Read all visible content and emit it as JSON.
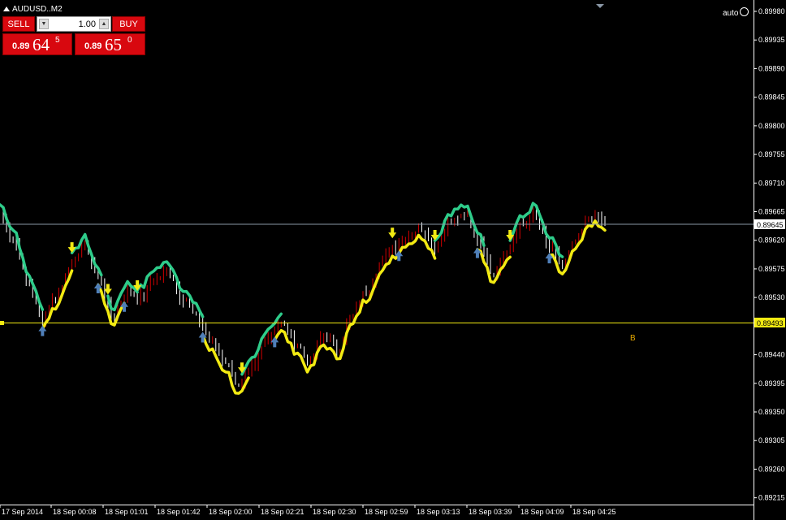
{
  "window": {
    "title": "AUDUSD..M2",
    "auto_label": "auto"
  },
  "trade_panel": {
    "sell_label": "SELL",
    "buy_label": "BUY",
    "lot_value": "1.00",
    "sell_price": {
      "big": "0.89",
      "pips": "64",
      "frac": "5"
    },
    "buy_price": {
      "big": "0.89",
      "pips": "65",
      "frac": "0"
    }
  },
  "chart_data": {
    "type": "bar",
    "symbol": "AUDUSD..",
    "timeframe": "M2",
    "ylim": [
      0.89212,
      0.8998
    ],
    "y_ticks": [
      "0.89980",
      "0.89935",
      "0.89890",
      "0.89845",
      "0.89800",
      "0.89755",
      "0.89710",
      "0.89665",
      "0.89620",
      "0.89575",
      "0.89530",
      "0.89440",
      "0.89395",
      "0.89350",
      "0.89305",
      "0.89260",
      "0.89215"
    ],
    "x_ticks": [
      "17 Sep 2014",
      "18 Sep 00:08",
      "18 Sep 01:01",
      "18 Sep 01:42",
      "18 Sep 02:00",
      "18 Sep 02:21",
      "18 Sep 02:30",
      "18 Sep 02:59",
      "18 Sep 03:13",
      "18 Sep 03:39",
      "18 Sep 04:09",
      "18 Sep 04:25"
    ],
    "current_price": "0.89645",
    "b_level_price": "0.89493",
    "b_label": "B",
    "colors": {
      "bull": "#d00000",
      "bear": "#ffffff",
      "resistance": "#2ecc8a",
      "support": "#f2ea12",
      "buy_arrow": "#4f7fb8",
      "sell_arrow": "#f2ea12",
      "b_label": "#e6a800"
    },
    "price_path": [
      0.8966,
      0.8962,
      0.8955,
      0.895,
      0.8953,
      0.8958,
      0.8961,
      0.8956,
      0.895,
      0.8954,
      0.8953,
      0.8956,
      0.8957,
      0.8953,
      0.895,
      0.8946,
      0.8943,
      0.8939,
      0.8942,
      0.8947,
      0.8949,
      0.8946,
      0.8943,
      0.8947,
      0.8945,
      0.895,
      0.8954,
      0.8958,
      0.8961,
      0.8963,
      0.8964,
      0.8961,
      0.8965,
      0.8966,
      0.8962,
      0.8957,
      0.896,
      0.8964,
      0.8966,
      0.8961,
      0.8958,
      0.8962,
      0.8966,
      0.8965
    ]
  }
}
